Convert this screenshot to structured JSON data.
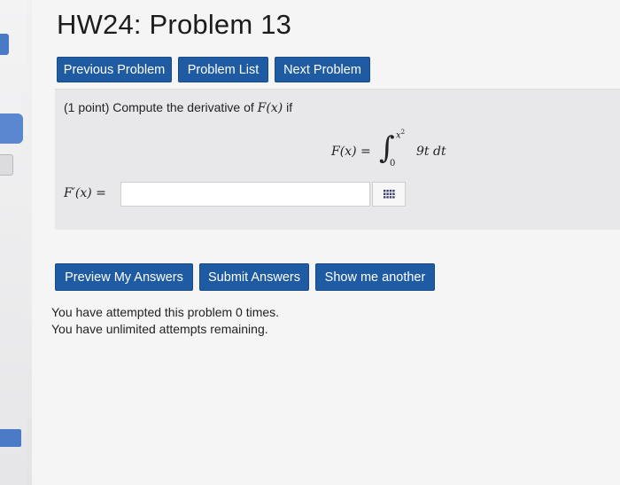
{
  "title": "HW24: Problem 13",
  "nav": {
    "previous_label": "Previous Problem",
    "list_label": "Problem List",
    "next_label": "Next Problem"
  },
  "problem": {
    "points": "(1 point)",
    "prompt": "Compute the derivative of",
    "function_name": "F(x)",
    "prompt_suffix": "if",
    "formula": {
      "lhs": "F(x) =",
      "integral_sign": "∫",
      "upper_limit_base": "x",
      "upper_limit_exp": "2",
      "lower_limit": "0",
      "integrand": "9t dt"
    },
    "answer_label": "F′(x) =",
    "answer_value": "",
    "answer_placeholder": ""
  },
  "actions": {
    "preview_label": "Preview My Answers",
    "submit_label": "Submit Answers",
    "another_label": "Show me another"
  },
  "status": {
    "attempts": "You have attempted this problem 0 times.",
    "remaining": "You have unlimited attempts remaining."
  },
  "colors": {
    "button_blue": "#1f5ba3",
    "sidebar_accent": "#4a79c5"
  }
}
